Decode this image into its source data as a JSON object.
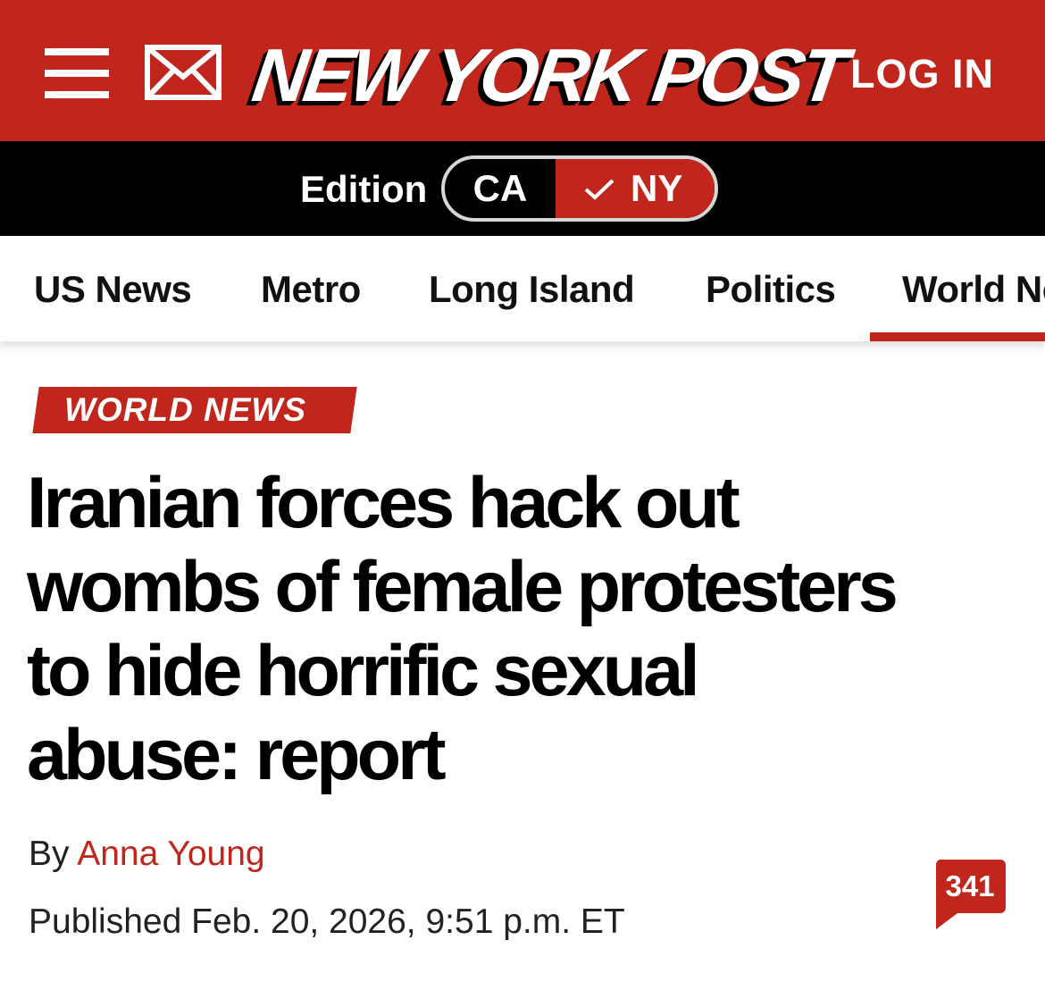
{
  "header": {
    "logo_text": "NEW YORK POST",
    "login_label": "LOG IN",
    "menu_icon": "hamburger-menu-icon",
    "mail_icon": "envelope-icon"
  },
  "edition": {
    "label": "Edition",
    "options": [
      "CA",
      "NY"
    ],
    "selected": "NY"
  },
  "sections": {
    "items": [
      "US News",
      "Metro",
      "Long Island",
      "Politics",
      "World News"
    ],
    "active": "World News"
  },
  "article": {
    "kicker": "WORLD NEWS",
    "headline_lines": [
      "Iranian forces hack out",
      "wombs of female protesters",
      "to hide horrific sexual",
      "abuse: report"
    ],
    "byline_prefix": "By",
    "author": "Anna Young",
    "published": "Published Feb. 20, 2026, 9:51 p.m. ET",
    "comment_count": "341"
  },
  "colors": {
    "brand_red": "#c0261c",
    "black": "#000000",
    "white": "#ffffff"
  }
}
